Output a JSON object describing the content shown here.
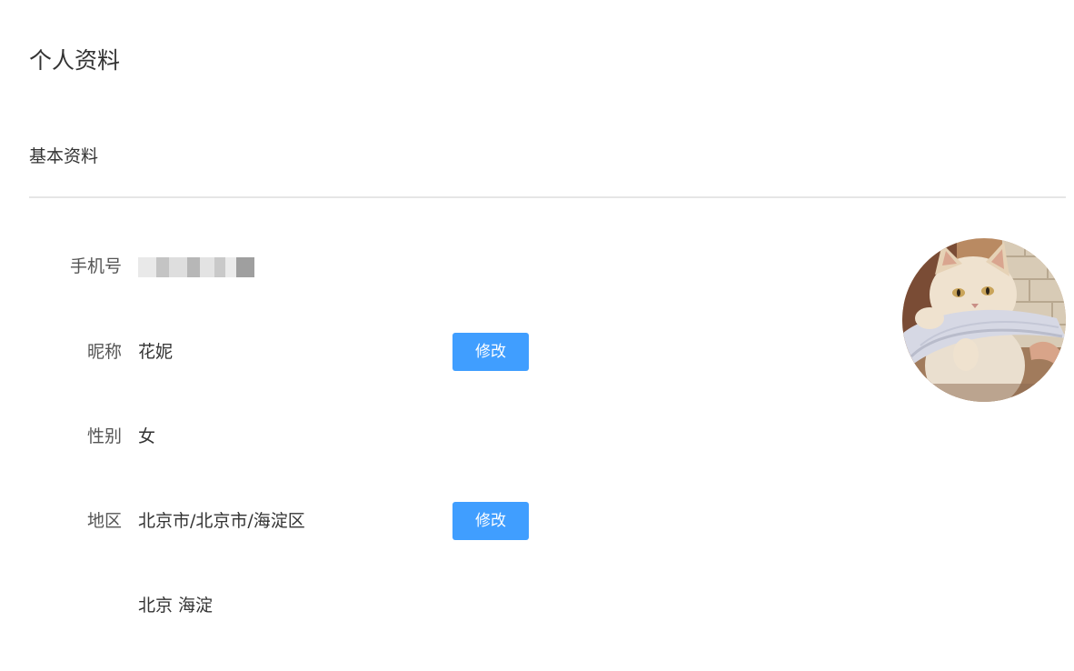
{
  "page": {
    "title": "个人资料"
  },
  "section": {
    "title": "基本资料"
  },
  "profile": {
    "phone": {
      "label": "手机号",
      "value": ""
    },
    "nickname": {
      "label": "昵称",
      "value": "花妮",
      "edit_label": "修改"
    },
    "gender": {
      "label": "性别",
      "value": "女"
    },
    "region": {
      "label": "地区",
      "value": "北京市/北京市/海淀区",
      "edit_label": "修改"
    },
    "address": {
      "value": "北京 海淀"
    }
  },
  "colors": {
    "accent": "#409eff",
    "divider": "#e6e6e6",
    "text": "#333333"
  },
  "avatar": {
    "icon": "cat-avatar"
  }
}
